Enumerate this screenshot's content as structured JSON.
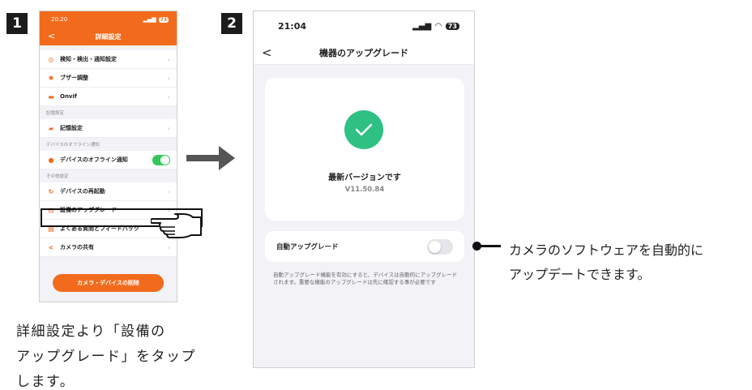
{
  "steps": [
    "1",
    "2"
  ],
  "phone1": {
    "status": {
      "time": "20:20",
      "battery": "73"
    },
    "title": "詳細設定",
    "items": [
      {
        "label": "検知・検出・通知設定"
      },
      {
        "label": "ブザー調整"
      },
      {
        "label": "Onvif"
      }
    ],
    "section_storage": "記憶設定",
    "storage_item": "記憶設定",
    "section_offline": "デバイスのオフライン通知",
    "offline_item": "デバイスのオフライン通知",
    "section_other": "その他設定",
    "other_items": [
      {
        "label": "デバイスの再起動"
      },
      {
        "label": "設備のアップグレード"
      },
      {
        "label": "よくある質問とフィードバック"
      },
      {
        "label": "カメラの共有"
      }
    ],
    "delete_button": "カメラ・デバイスの削除"
  },
  "caption_lines": [
    "詳細設定より「設備の",
    "アップグレード」をタップ",
    "します。"
  ],
  "phone2": {
    "status": {
      "time": "21:04",
      "battery": "73"
    },
    "title": "機器のアップグレード",
    "latest_label": "最新バージョンです",
    "version": "V11.50.84",
    "auto_label": "自動アップグレード",
    "auto_enabled": false,
    "description": "自動アップグレード機能を有効にすると、デバイスは自動的にアップグレードされます。重要な機能のアップグレードは先に確認する事が必要です"
  },
  "callout_lines": [
    "カメラのソフトウェアを自動的に",
    "アップデートできます。"
  ],
  "colors": {
    "accent": "#f26b1d",
    "success": "#2fc084",
    "toggle_on": "#34c759"
  }
}
